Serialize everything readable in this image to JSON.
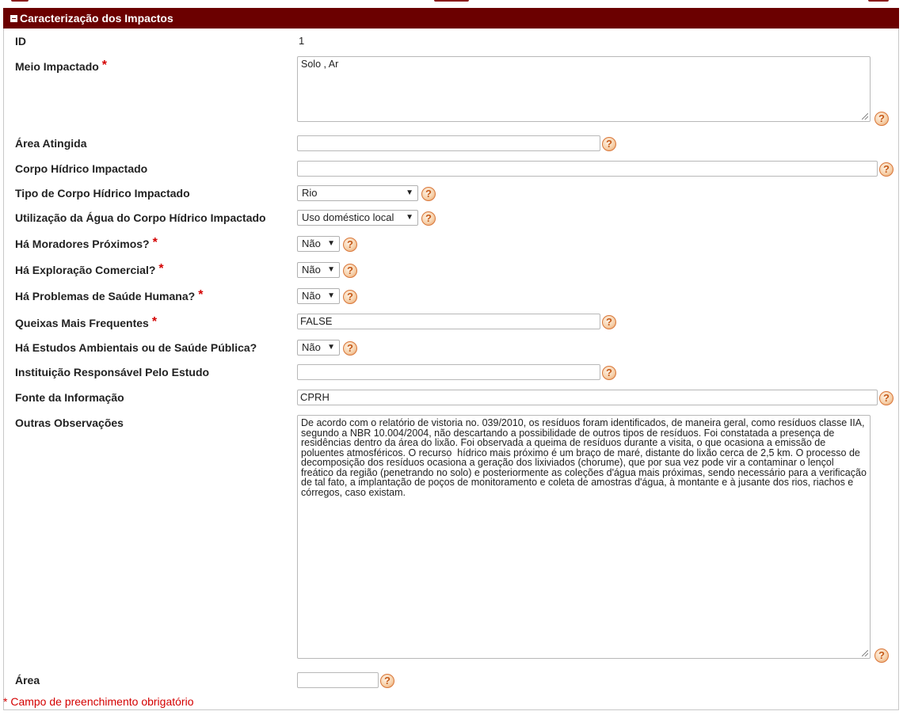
{
  "panel": {
    "title": "Caracterização dos Impactos"
  },
  "fields": {
    "id": {
      "label": "ID",
      "value": "1"
    },
    "meio_impactado": {
      "label": "Meio Impactado",
      "required": "*",
      "value": "Solo , Ar"
    },
    "area_atingida": {
      "label": "Área Atingida",
      "value": ""
    },
    "corpo_hidrico": {
      "label": "Corpo Hídrico Impactado",
      "value": ""
    },
    "tipo_corpo_hidrico": {
      "label": "Tipo de Corpo Hídrico Impactado",
      "value": "Rio"
    },
    "utilizacao_agua": {
      "label": "Utilização da Água do Corpo Hídrico Impactado",
      "value": "Uso doméstico local"
    },
    "moradores_proximos": {
      "label": "Há Moradores Próximos?",
      "required": "*",
      "value": "Não"
    },
    "exploracao_comercial": {
      "label": "Há Exploração Comercial?",
      "required": "*",
      "value": "Não"
    },
    "problemas_saude": {
      "label": "Há Problemas de Saúde Humana?",
      "required": "*",
      "value": "Não"
    },
    "queixas": {
      "label": "Queixas Mais Frequentes",
      "required": "*",
      "value": "FALSE"
    },
    "estudos": {
      "label": "Há Estudos Ambientais ou de Saúde Pública?",
      "value": "Não"
    },
    "instituicao": {
      "label": "Instituição Responsável Pelo Estudo",
      "value": ""
    },
    "fonte": {
      "label": "Fonte da Informação",
      "value": "CPRH"
    },
    "observacoes": {
      "label": "Outras Observações",
      "value": "De acordo com o relatório de vistoria no. 039/2010, os resíduos foram identificados, de maneira geral, como resíduos classe IIA, segundo a NBR 10.004/2004, não descartando a possibilidade de outros tipos de resíduos. Foi constatada a presença de residências dentro da área do lixão. Foi observada a queima de resíduos durante a visita, o que ocasiona a emissão de poluentes atmosféricos. O recurso  hídrico mais próximo é um braço de maré, distante do lixão cerca de 2,5 km. O processo de decomposição dos resíduos ocasiona a geração dos lixiviados (chorume), que por sua vez pode vir a contaminar o lençol freático da região (penetrando no solo) e posteriormente as coleções d'água mais próximas, sendo necessário para a verificação de tal fato, a implantação de poços de monitoramento e coleta de amostras d'água, à montante e à jusante dos rios, riachos e córregos, caso existam."
    },
    "area": {
      "label": "Área",
      "value": ""
    }
  },
  "help_symbol": "?",
  "dropdown_arrow": "▼",
  "footnote": "* Campo de preenchimento obrigatório",
  "colors": {
    "header_bg": "#6b0000",
    "required": "#d40000",
    "help_border": "#d9773a"
  },
  "icons": {
    "help": "question-circle-icon",
    "collapse": "minus-square-icon",
    "dropdown": "chevron-down-icon"
  }
}
